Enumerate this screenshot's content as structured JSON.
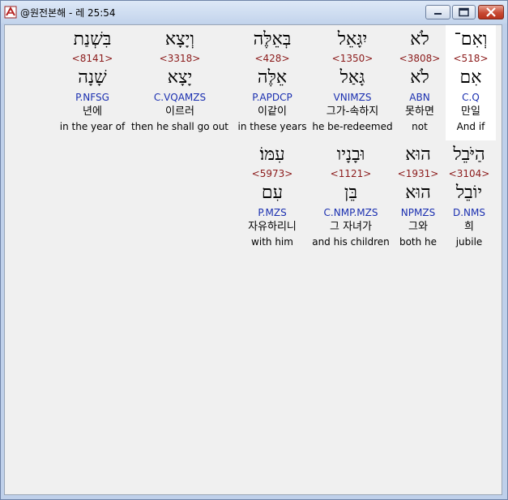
{
  "window": {
    "title": "@원전본해 - 레 25:54"
  },
  "rows": [
    [
      {
        "heb": "וְאִם־",
        "strong": "<518>",
        "lemma": "אִם",
        "parse": "C.Q",
        "kor": "만일",
        "eng": "And if",
        "highlight": true
      },
      {
        "heb": "לֹא",
        "strong": "<3808>",
        "lemma": "לֹא",
        "parse": "ABN",
        "kor": "못하면",
        "eng": "not"
      },
      {
        "heb": "יִגָּאֵל",
        "strong": "<1350>",
        "lemma": "גָּאַל",
        "parse": "VNIMZS",
        "kor": "그가-속하지",
        "eng": "he be-redeemed"
      },
      {
        "heb": "בְּאֵלֶּה",
        "strong": "<428>",
        "lemma": "אֵלֶּה",
        "parse": "P.APDCP",
        "kor": "이같이",
        "eng": "in these years"
      },
      {
        "heb": "וְיָצָא",
        "strong": "<3318>",
        "lemma": "יָצָא",
        "parse": "C.VQAMZS",
        "kor": "이르러",
        "eng": "then he shall go out"
      },
      {
        "heb": "בִּשְׁנַת",
        "strong": "<8141>",
        "lemma": "שָׁנָה",
        "parse": "P.NFSG",
        "kor": "년에",
        "eng": "in the year of"
      }
    ],
    [
      {
        "heb": "הַיֹּבֵל",
        "strong": "<3104>",
        "lemma": "יוֹבֵל",
        "parse": "D.NMS",
        "kor": "희",
        "eng": "jubile"
      },
      {
        "heb": "הוּא",
        "strong": "<1931>",
        "lemma": "הוּא",
        "parse": "NPMZS",
        "kor": "그와",
        "eng": "both he"
      },
      {
        "heb": "וּבָנָיו",
        "strong": "<1121>",
        "lemma": "בֵּן",
        "parse": "C.NMP.MZS",
        "kor": "그 자녀가",
        "eng": "and his children"
      },
      {
        "heb": "עִמּוֹ׃",
        "strong": "<5973>",
        "lemma": "עִם",
        "parse": "P.MZS",
        "kor": "자유하리니",
        "eng": "with him"
      }
    ]
  ]
}
